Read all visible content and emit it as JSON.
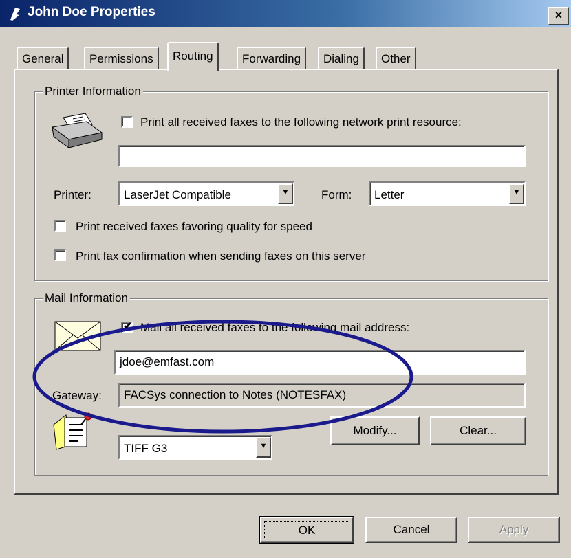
{
  "window": {
    "title": "John Doe Properties",
    "close_glyph": "×"
  },
  "tabs": [
    {
      "label": "General"
    },
    {
      "label": "Permissions"
    },
    {
      "label": "Routing",
      "active": true
    },
    {
      "label": "Forwarding"
    },
    {
      "label": "Dialing"
    },
    {
      "label": "Other"
    }
  ],
  "printer": {
    "legend": "Printer Information",
    "print_all_label": "Print all received faxes to the following network print resource:",
    "print_all_checked": false,
    "resource_value": "",
    "printer_label": "Printer:",
    "printer_value": "LaserJet Compatible",
    "form_label": "Form:",
    "form_value": "Letter",
    "quality_label": "Print received faxes favoring quality for speed",
    "confirm_label": "Print fax confirmation when sending faxes on this server"
  },
  "mail": {
    "legend": "Mail Information",
    "mail_all_label": "Mail all received faxes to the following mail address:",
    "mail_all_checked": true,
    "address_value": "jdoe@emfast.com",
    "gateway_label": "Gateway:",
    "gateway_value": "FACSys connection to Notes (NOTESFAX)",
    "modify_label": "Modify...",
    "clear_label": "Clear...",
    "format_value": "TIFF G3"
  },
  "footer": {
    "ok_label": "OK",
    "cancel_label": "Cancel",
    "apply_label": "Apply"
  },
  "dropdown_glyph": "▼",
  "check_glyph": "✔",
  "colors": {
    "titlebar": "#0a246a",
    "face": "#d4d0c8",
    "annotation_ellipse": "#1a1a8c"
  }
}
